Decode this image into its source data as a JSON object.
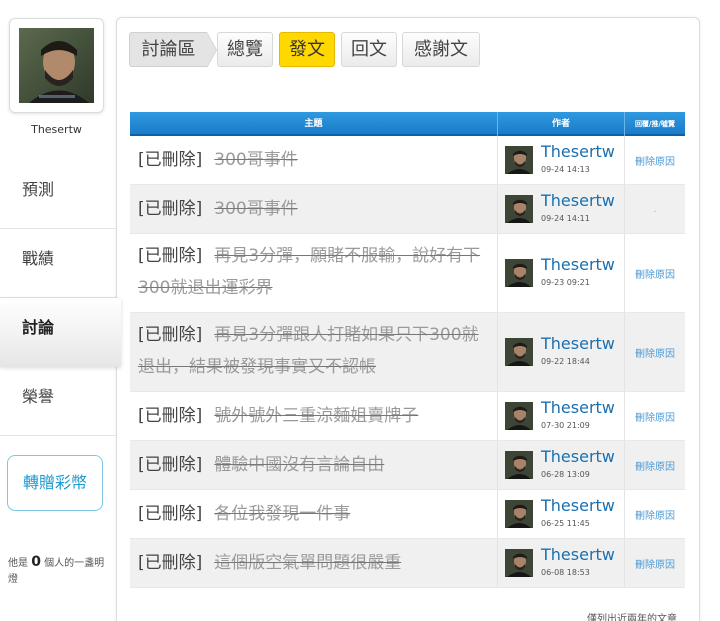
{
  "colors": {
    "accent_blue": "#1b7bc8",
    "active_tab_yellow": "#ffd800",
    "link_blue": "#1a6fb0",
    "transfer_border": "#7cc8e4"
  },
  "user": {
    "name": "Thesertw"
  },
  "nav": {
    "items": [
      {
        "label": "預測"
      },
      {
        "label": "戰績"
      },
      {
        "label": "討論"
      },
      {
        "label": "榮譽"
      }
    ],
    "active_index": 2
  },
  "transfer_button": {
    "label": "轉贈彩幣"
  },
  "lamp": {
    "prefix": "他是",
    "count": "0",
    "suffix": "個人的一盞明燈"
  },
  "tabs": {
    "home": "討論區",
    "overview": "總覽",
    "posts": "發文",
    "replies": "回文",
    "thanks": "感謝文"
  },
  "table": {
    "headers": {
      "subject": "主題",
      "author": "作者",
      "reply": "回覆/推/噓覽"
    },
    "rows": [
      {
        "tag": "[已刪除]",
        "title": "300哥事件",
        "author": "Thesertw",
        "time": "09-24 14:13",
        "reply": "刪除原因"
      },
      {
        "tag": "[已刪除]",
        "title": "300哥事件",
        "author": "Thesertw",
        "time": "09-24 14:11",
        "reply": "."
      },
      {
        "tag": "[已刪除]",
        "title": "再見3分彈，願賭不服輸，說好有下300就退出運彩界",
        "author": "Thesertw",
        "time": "09-23 09:21",
        "reply": "刪除原因"
      },
      {
        "tag": "[已刪除]",
        "title": "再見3分彈跟人打賭如果只下300就退出，結果被發現事實又不認帳",
        "author": "Thesertw",
        "time": "09-22 18:44",
        "reply": "刪除原因"
      },
      {
        "tag": "[已刪除]",
        "title": "號外號外三重涼麵姐賣牌子",
        "author": "Thesertw",
        "time": "07-30 21:09",
        "reply": "刪除原因"
      },
      {
        "tag": "[已刪除]",
        "title": "體驗中國沒有言論自由",
        "author": "Thesertw",
        "time": "06-28 13:09",
        "reply": "刪除原因"
      },
      {
        "tag": "[已刪除]",
        "title": "各位我發現一件事",
        "author": "Thesertw",
        "time": "06-25 11:45",
        "reply": "刪除原因"
      },
      {
        "tag": "[已刪除]",
        "title": "這個版空氣單問題很嚴重",
        "author": "Thesertw",
        "time": "06-08 18:53",
        "reply": "刪除原因"
      }
    ]
  },
  "footer": {
    "note": "僅列出近兩年的文章"
  }
}
